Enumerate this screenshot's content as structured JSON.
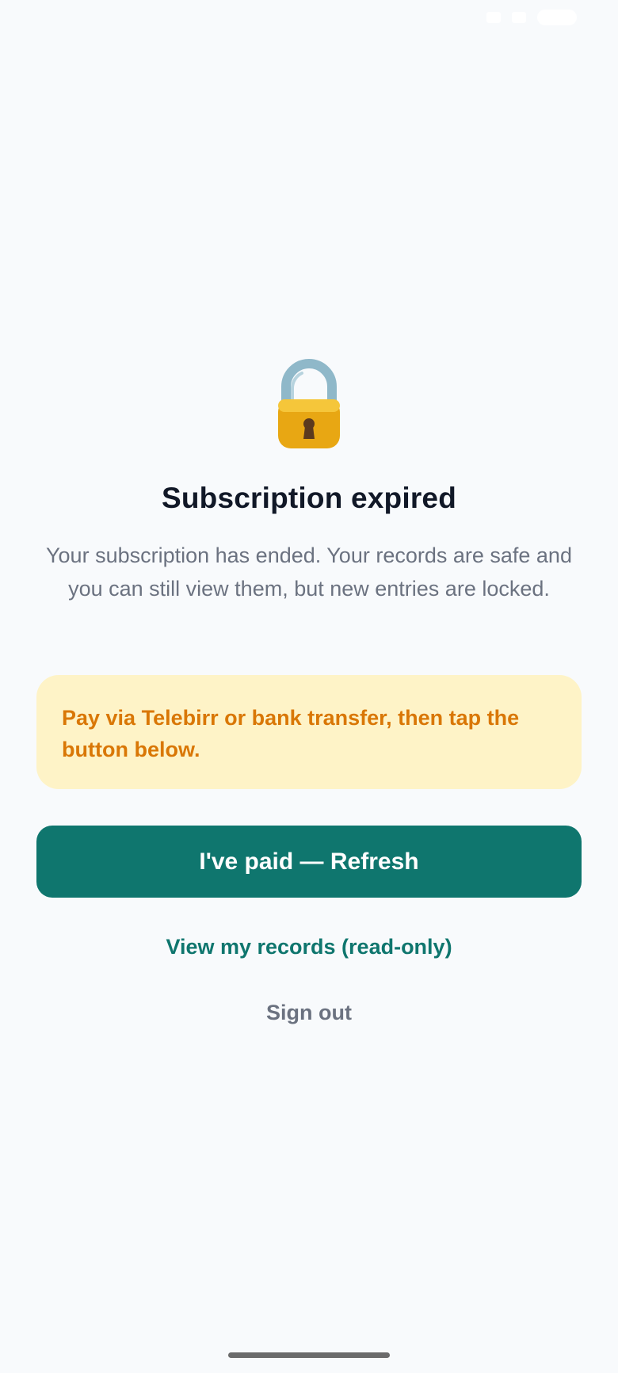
{
  "status_bar": {
    "time": "",
    "icons": [
      "wifi-icon",
      "signal-icon",
      "battery-icon"
    ]
  },
  "lock": {
    "icon": "lock-icon",
    "colors": {
      "body": "#f2b824",
      "shackle": "#8fb8c9",
      "keyhole": "#5b3a1e"
    }
  },
  "title": "Subscription expired",
  "description": "Your subscription has ended. Your records are safe and you can still view them, but new entries are locked.",
  "notice": {
    "text": "Pay via Telebirr or bank transfer, then tap the button below."
  },
  "actions": {
    "primary_label": "I've paid — Refresh",
    "view_records_label": "View my records (read-only)",
    "sign_out_label": "Sign out"
  },
  "colors": {
    "accent": "#0f766e",
    "notice_bg": "#fef3c7",
    "notice_text": "#d97706",
    "title": "#111827",
    "muted": "#6b7280",
    "background": "#f8fafc"
  }
}
